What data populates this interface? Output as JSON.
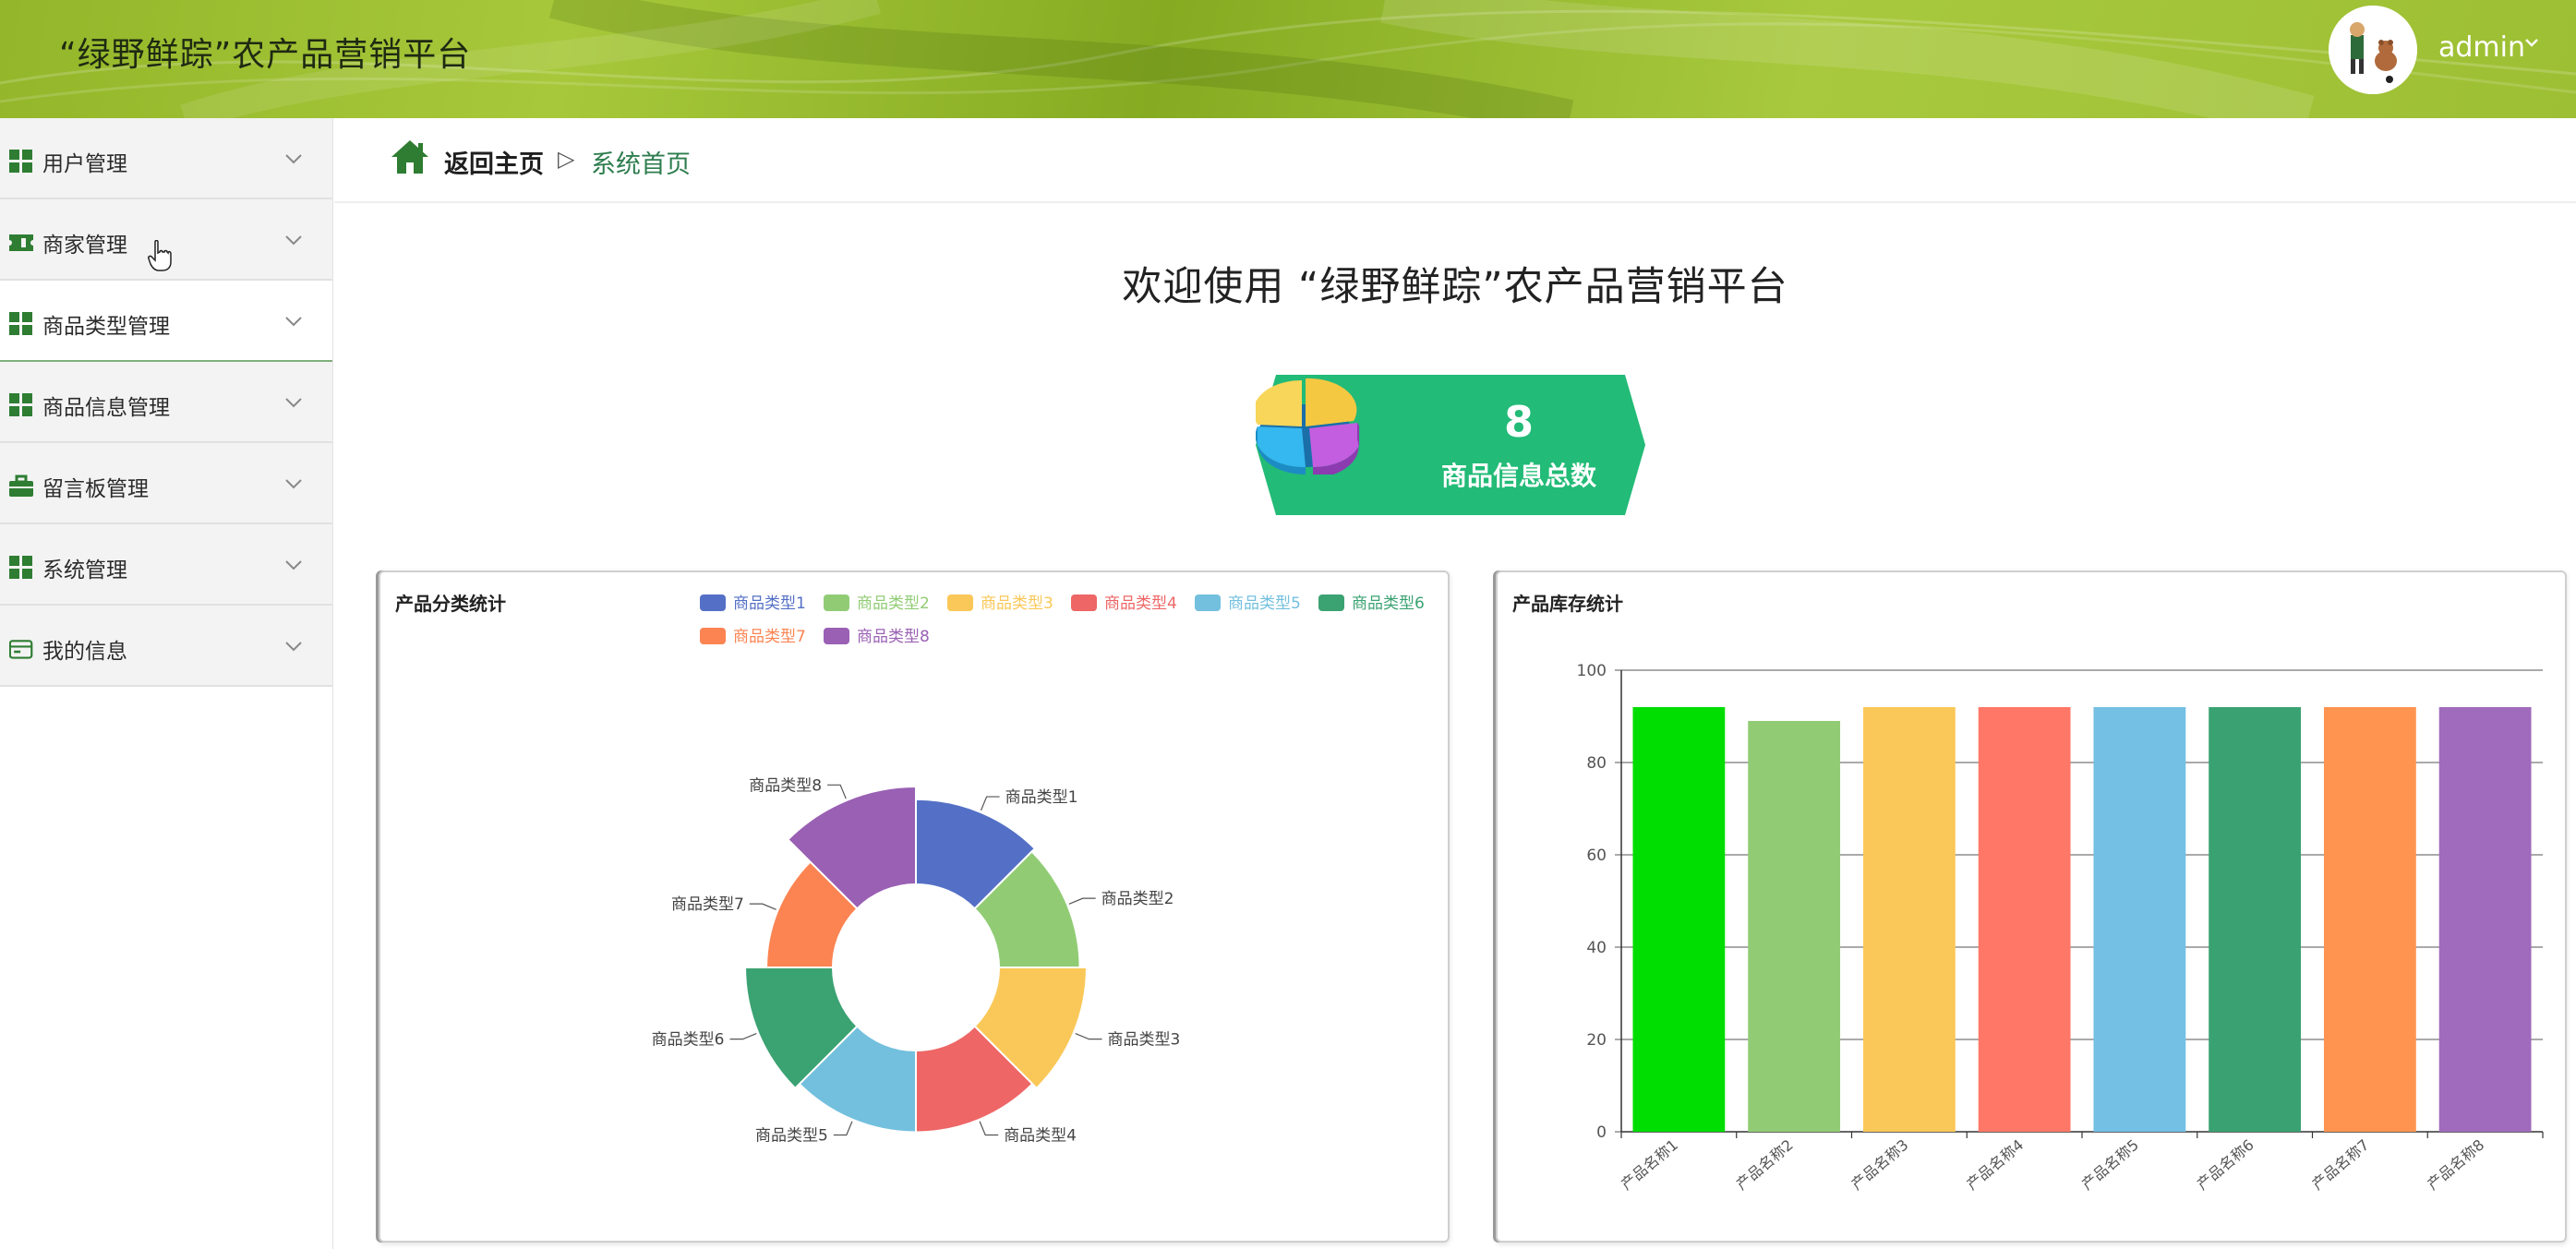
{
  "header": {
    "app_title": "“绿野鲜踪”农产品营销平台",
    "user_name": "admin"
  },
  "sidebar": {
    "items": [
      {
        "label": "用户管理",
        "icon": "grid-icon"
      },
      {
        "label": "商家管理",
        "icon": "ticket-icon"
      },
      {
        "label": "商品类型管理",
        "icon": "grid-icon"
      },
      {
        "label": "商品信息管理",
        "icon": "grid-icon"
      },
      {
        "label": "留言板管理",
        "icon": "briefcase-icon"
      },
      {
        "label": "系统管理",
        "icon": "grid-icon"
      },
      {
        "label": "我的信息",
        "icon": "wallet-icon"
      }
    ]
  },
  "breadcrumb": {
    "home": "返回主页",
    "separator": "▷",
    "current": "系统首页"
  },
  "welcome": "欢迎使用 “绿野鲜踪”农产品营销平台",
  "stat_card": {
    "value": "8",
    "label": "商品信息总数",
    "color": "#22bb77"
  },
  "colors": {
    "header": "#9dbf33",
    "accent_green": "#2e7d32"
  },
  "chart_data": [
    {
      "type": "pie",
      "variant": "rose-donut",
      "title": "产品分类统计",
      "legend_position": "top-right",
      "categories": [
        "商品类型1",
        "商品类型2",
        "商品类型3",
        "商品类型4",
        "商品类型5",
        "商品类型6",
        "商品类型7",
        "商品类型8"
      ],
      "values": [
        100,
        95,
        103,
        96,
        96,
        103,
        78,
        115
      ],
      "colors": [
        "#5470c6",
        "#91cc75",
        "#fac858",
        "#ee6666",
        "#73c0de",
        "#3ba272",
        "#fc8452",
        "#9a60b4"
      ]
    },
    {
      "type": "bar",
      "title": "产品库存统计",
      "categories": [
        "产品名称1",
        "产品名称2",
        "产品名称3",
        "产品名称4",
        "产品名称5",
        "产品名称6",
        "产品名称7",
        "产品名称8"
      ],
      "values": [
        92,
        89,
        92,
        92,
        92,
        92,
        92,
        92
      ],
      "ylim": [
        0,
        100
      ],
      "yticks": [
        0,
        20,
        40,
        60,
        80,
        100
      ],
      "grid": true,
      "colors": [
        "#00dd00",
        "#91cc75",
        "#fac858",
        "#ff7766",
        "#73c0e4",
        "#3aa272",
        "#ff9450",
        "#a06bbc"
      ]
    }
  ]
}
